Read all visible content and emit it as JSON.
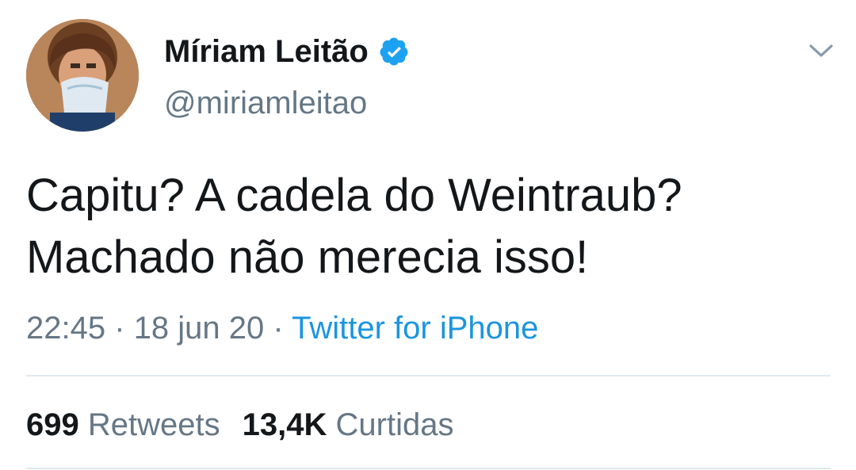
{
  "user": {
    "display_name": "Míriam Leitão",
    "handle": "@miriamleitao",
    "verified": true
  },
  "tweet": {
    "lines": [
      "Capitu? A cadela do Weintraub?",
      "Machado não merecia isso!"
    ],
    "time": "22:45",
    "separator": "·",
    "date": "18 jun 20",
    "source": "Twitter for iPhone"
  },
  "stats": {
    "retweets_count": "699",
    "retweets_label": "Retweets",
    "likes_count": "13,4K",
    "likes_label": "Curtidas"
  },
  "icons": {
    "verified": "verified-badge-icon",
    "caret": "chevron-down-icon"
  },
  "colors": {
    "text": "#14171a",
    "secondary": "#657786",
    "link": "#1b95e0",
    "verified": "#1da1f2",
    "divider": "#e1e8ed"
  }
}
